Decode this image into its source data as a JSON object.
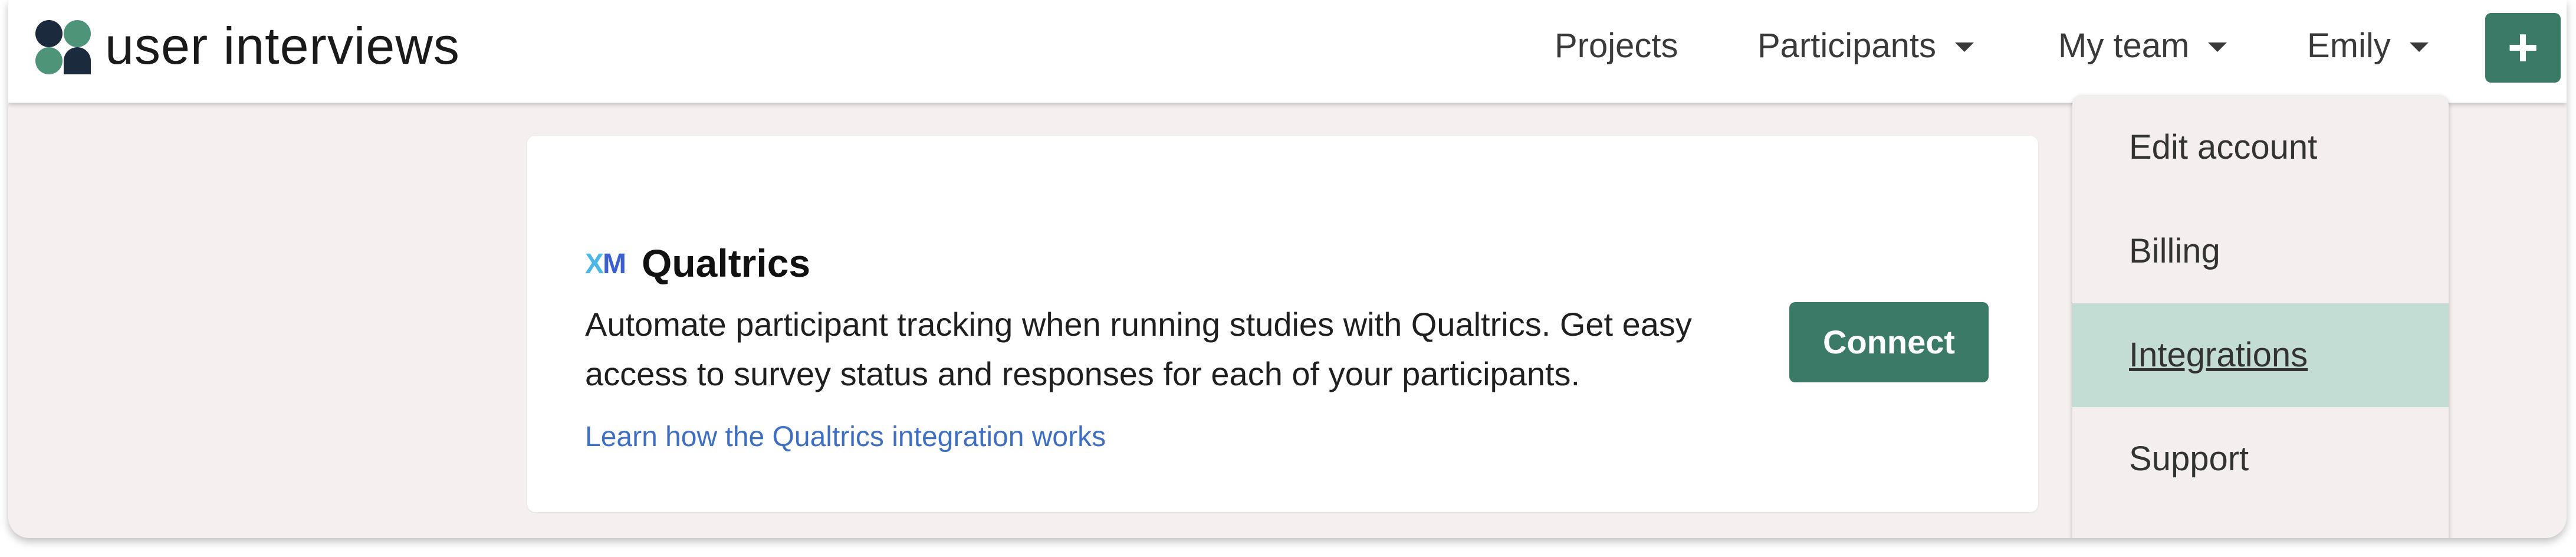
{
  "brand": {
    "name": "user interviews"
  },
  "nav": {
    "projects": "Projects",
    "participants": "Participants",
    "my_team": "My team",
    "user": "Emily",
    "add_button": "+"
  },
  "integration": {
    "logo_text": {
      "x": "X",
      "m": "M"
    },
    "title": "Qualtrics",
    "description": "Automate participant tracking when running studies with Qualtrics. Get easy access to survey status and responses for each of your participants.",
    "link": "Learn how the Qualtrics integration works",
    "connect_label": "Connect"
  },
  "user_menu": {
    "items": [
      "Edit account",
      "Billing",
      "Integrations",
      "Support"
    ],
    "active": "Integrations"
  },
  "colors": {
    "accent": "#3a7a66",
    "active_menu_bg": "#c4ddd4",
    "page_bg": "#f5f0ef",
    "link": "#3f6fc0"
  }
}
